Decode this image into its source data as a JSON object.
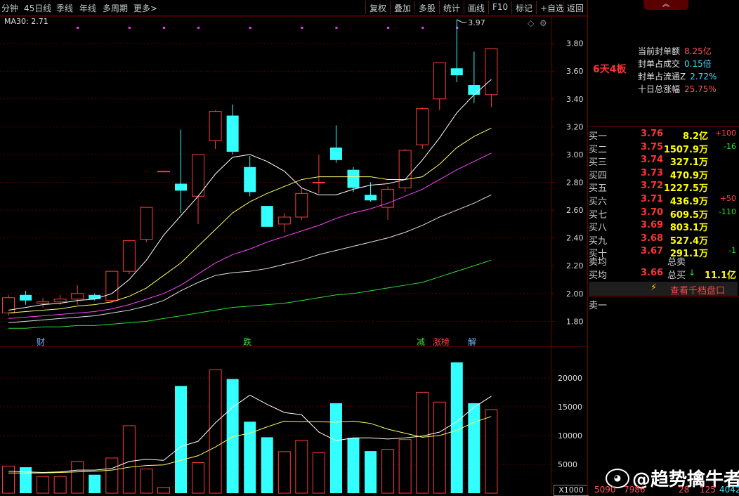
{
  "toolbar": {
    "left_items": [
      "分钟",
      "45日线",
      "季线",
      "年线",
      "多周期",
      "更多>"
    ],
    "buttons": [
      "复权",
      "叠加",
      "多股",
      "统计",
      "画线",
      "F10",
      "标记",
      "+自选",
      "返回"
    ]
  },
  "chart": {
    "ma_label": "MA30: 2.71",
    "price_ticks": [
      "3.80",
      "3.60",
      "3.40",
      "3.20",
      "3.00",
      "2.80",
      "2.60",
      "2.40",
      "2.20",
      "2.00",
      "1.80"
    ],
    "volume_ticks": [
      "20000",
      "15000",
      "10000",
      "5000"
    ],
    "high_label": "3.97",
    "volume_unit": "X1000",
    "event_tags": [
      {
        "text": "财",
        "color": "#6fb6ff"
      },
      {
        "text": "跌",
        "color": "#33dd33"
      },
      {
        "text": "减",
        "color": "#33dd33"
      },
      {
        "text": "涨榜",
        "color": "#ff4444"
      },
      {
        "text": "解",
        "color": "#6fb6ff"
      }
    ]
  },
  "chart_data": {
    "type": "candlestick",
    "price_ylim": [
      1.62,
      3.97
    ],
    "volume_ylim": [
      0,
      24000
    ],
    "candles": [
      {
        "o": 1.86,
        "c": 1.97,
        "h": 1.99,
        "l": 1.84,
        "v": 4700,
        "up": true
      },
      {
        "o": 1.99,
        "c": 1.95,
        "h": 2.02,
        "l": 1.92,
        "v": 4500,
        "up": false
      },
      {
        "o": 1.94,
        "c": 1.93,
        "h": 1.97,
        "l": 1.9,
        "v": 2900,
        "up": true
      },
      {
        "o": 1.94,
        "c": 1.96,
        "h": 1.99,
        "l": 1.92,
        "v": 2900,
        "up": true
      },
      {
        "o": 1.96,
        "c": 2.0,
        "h": 2.06,
        "l": 1.92,
        "v": 5500,
        "up": true
      },
      {
        "o": 1.99,
        "c": 1.96,
        "h": 2.0,
        "l": 1.95,
        "v": 3200,
        "up": false
      },
      {
        "o": 1.95,
        "c": 2.16,
        "h": 2.16,
        "l": 1.93,
        "v": 6100,
        "up": true
      },
      {
        "o": 2.16,
        "c": 2.38,
        "h": 2.38,
        "l": 2.14,
        "v": 11700,
        "up": true
      },
      {
        "o": 2.39,
        "c": 2.62,
        "h": 2.62,
        "l": 2.37,
        "v": 4200,
        "up": true
      },
      {
        "o": 2.88,
        "c": 2.88,
        "h": 2.88,
        "l": 2.88,
        "v": 1000,
        "up": true
      },
      {
        "o": 2.79,
        "c": 2.74,
        "h": 3.18,
        "l": 2.58,
        "v": 18600,
        "up": false
      },
      {
        "o": 2.7,
        "c": 3.0,
        "h": 3.0,
        "l": 2.5,
        "v": 5300,
        "up": true
      },
      {
        "o": 3.1,
        "c": 3.31,
        "h": 3.32,
        "l": 3.04,
        "v": 21400,
        "up": true
      },
      {
        "o": 3.28,
        "c": 3.02,
        "h": 3.36,
        "l": 3.0,
        "v": 19800,
        "up": false
      },
      {
        "o": 2.91,
        "c": 2.73,
        "h": 2.99,
        "l": 2.7,
        "v": 12400,
        "up": false
      },
      {
        "o": 2.63,
        "c": 2.48,
        "h": 2.63,
        "l": 2.48,
        "v": 9700,
        "up": false
      },
      {
        "o": 2.5,
        "c": 2.55,
        "h": 2.58,
        "l": 2.44,
        "v": 7200,
        "up": true
      },
      {
        "o": 2.55,
        "c": 2.72,
        "h": 2.76,
        "l": 2.53,
        "v": 9200,
        "up": true
      },
      {
        "o": 2.8,
        "c": 2.8,
        "h": 3.0,
        "l": 2.72,
        "v": 7000,
        "up": true
      },
      {
        "o": 3.05,
        "c": 2.96,
        "h": 3.21,
        "l": 2.94,
        "v": 15600,
        "up": false
      },
      {
        "o": 2.89,
        "c": 2.76,
        "h": 2.91,
        "l": 2.73,
        "v": 9600,
        "up": false
      },
      {
        "o": 2.71,
        "c": 2.67,
        "h": 2.8,
        "l": 2.66,
        "v": 7300,
        "up": false
      },
      {
        "o": 2.62,
        "c": 2.75,
        "h": 2.77,
        "l": 2.53,
        "v": 7600,
        "up": true
      },
      {
        "o": 2.76,
        "c": 3.03,
        "h": 3.04,
        "l": 2.73,
        "v": 9300,
        "up": true
      },
      {
        "o": 3.07,
        "c": 3.33,
        "h": 3.34,
        "l": 3.04,
        "v": 17500,
        "up": true
      },
      {
        "o": 3.4,
        "c": 3.66,
        "h": 3.66,
        "l": 3.32,
        "v": 15800,
        "up": true
      },
      {
        "o": 3.62,
        "c": 3.57,
        "h": 3.97,
        "l": 3.52,
        "v": 22700,
        "up": false
      },
      {
        "o": 3.5,
        "c": 3.43,
        "h": 3.74,
        "l": 3.37,
        "v": 15600,
        "up": false
      },
      {
        "o": 3.43,
        "c": 3.76,
        "h": 3.76,
        "l": 3.34,
        "v": 14500,
        "up": true
      }
    ],
    "ma_lines": [
      {
        "color": "#ffffff",
        "values": [
          1.88,
          1.9,
          1.92,
          1.93,
          1.95,
          1.96,
          2.0,
          2.1,
          2.24,
          2.42,
          2.56,
          2.7,
          2.86,
          2.98,
          3.0,
          2.95,
          2.88,
          2.76,
          2.71,
          2.71,
          2.75,
          2.78,
          2.79,
          2.82,
          2.96,
          3.12,
          3.3,
          3.43,
          3.54
        ]
      },
      {
        "color": "#ffff66",
        "values": [
          1.86,
          1.87,
          1.88,
          1.89,
          1.91,
          1.92,
          1.94,
          1.98,
          2.04,
          2.13,
          2.22,
          2.34,
          2.46,
          2.58,
          2.66,
          2.72,
          2.77,
          2.82,
          2.84,
          2.84,
          2.84,
          2.84,
          2.82,
          2.82,
          2.84,
          2.93,
          3.05,
          3.13,
          3.19
        ]
      },
      {
        "color": "#ff44ff",
        "values": [
          1.82,
          1.83,
          1.84,
          1.85,
          1.86,
          1.87,
          1.89,
          1.92,
          1.96,
          2.0,
          2.06,
          2.14,
          2.22,
          2.28,
          2.32,
          2.37,
          2.41,
          2.45,
          2.49,
          2.54,
          2.58,
          2.61,
          2.65,
          2.7,
          2.75,
          2.82,
          2.89,
          2.95,
          3.01
        ]
      },
      {
        "color": "#e0e0e0",
        "values": [
          1.79,
          1.8,
          1.81,
          1.82,
          1.83,
          1.84,
          1.86,
          1.88,
          1.91,
          1.95,
          2.02,
          2.08,
          2.13,
          2.15,
          2.16,
          2.18,
          2.21,
          2.24,
          2.28,
          2.31,
          2.34,
          2.37,
          2.4,
          2.44,
          2.49,
          2.55,
          2.6,
          2.65,
          2.71
        ]
      },
      {
        "color": "#33dd33",
        "values": [
          1.75,
          1.75,
          1.76,
          1.76,
          1.77,
          1.77,
          1.78,
          1.79,
          1.8,
          1.82,
          1.84,
          1.86,
          1.88,
          1.9,
          1.91,
          1.92,
          1.93,
          1.95,
          1.97,
          1.99,
          2.0,
          2.02,
          2.04,
          2.06,
          2.08,
          2.12,
          2.16,
          2.2,
          2.24
        ]
      }
    ],
    "vol_ma_lines": [
      {
        "color": "#ffffff",
        "values": [
          3800,
          3700,
          3600,
          3700,
          4000,
          4000,
          4300,
          5500,
          5900,
          5700,
          8100,
          9000,
          12200,
          14900,
          17000,
          15400,
          14000,
          13600,
          10600,
          9100,
          9600,
          9600,
          9400,
          9600,
          9900,
          10600,
          12400,
          14900,
          16800
        ]
      },
      {
        "color": "#ffff66",
        "values": [
          3500,
          3500,
          3500,
          3600,
          3700,
          3800,
          4000,
          4500,
          4800,
          4900,
          5700,
          6500,
          8000,
          9800,
          10400,
          11500,
          12500,
          12400,
          12400,
          12300,
          12500,
          12100,
          11100,
          10400,
          9700,
          10000,
          10900,
          12300,
          13300
        ]
      }
    ]
  },
  "right_panel": {
    "collapse_icon": "chevron-up-icon",
    "boards": "6天4板",
    "info": [
      {
        "k": "当前封单额",
        "v": "8.25亿",
        "cls": "v"
      },
      {
        "k": "封单占成交",
        "v": "0.15倍",
        "cls": "vc"
      },
      {
        "k": "封单占流通Z",
        "v": "2.72%",
        "cls": "vc"
      },
      {
        "k": "十日总涨幅",
        "v": "25.75%",
        "cls": "v"
      }
    ],
    "order_book": [
      {
        "label": "买一",
        "price": "3.76",
        "vol": "8.2亿",
        "chg": "+100",
        "dir": "up"
      },
      {
        "label": "买二",
        "price": "3.75",
        "vol": "1507.9万",
        "chg": "-16",
        "dir": "dn"
      },
      {
        "label": "买三",
        "price": "3.74",
        "vol": "327.1万",
        "chg": "",
        "dir": ""
      },
      {
        "label": "买四",
        "price": "3.73",
        "vol": "470.9万",
        "chg": "",
        "dir": ""
      },
      {
        "label": "买五",
        "price": "3.72",
        "vol": "1227.5万",
        "chg": "",
        "dir": ""
      },
      {
        "label": "买六",
        "price": "3.71",
        "vol": "436.9万",
        "chg": "+50",
        "dir": "up"
      },
      {
        "label": "买七",
        "price": "3.70",
        "vol": "609.5万",
        "chg": "-110",
        "dir": "dn"
      },
      {
        "label": "买八",
        "price": "3.69",
        "vol": "803.1万",
        "chg": "",
        "dir": ""
      },
      {
        "label": "买九",
        "price": "3.68",
        "vol": "527.4万",
        "chg": "",
        "dir": ""
      },
      {
        "label": "买十",
        "price": "3.67",
        "vol": "291.1万",
        "chg": "-1",
        "dir": "dn"
      }
    ],
    "sell_avg_label": "卖均",
    "sell_total_label": "总卖",
    "buy_avg_label": "买均",
    "buy_avg_value": "3.66",
    "buy_total_label": "总买",
    "buy_total_value": "11.1亿",
    "qianpan_link": "查看千档盘口",
    "sell_one": "卖一",
    "watermark": "@趋势擒牛者",
    "bottom_numbers": [
      "5090",
      "7986",
      "28",
      "125",
      "4042"
    ]
  }
}
